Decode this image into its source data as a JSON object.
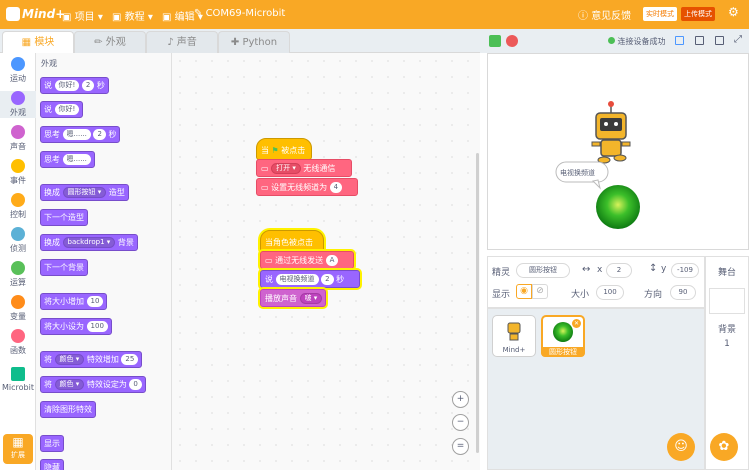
{
  "app": {
    "logo": "Mind+"
  },
  "menu": {
    "project": "项目",
    "tutorial": "教程",
    "edit": "编辑",
    "device": "COM69-Microbit"
  },
  "topright": {
    "feedback": "意见反馈",
    "realtime": "实时模式",
    "upload": "上传模式"
  },
  "tabs": [
    "模块",
    "外观",
    "声音",
    "Python"
  ],
  "stage_bar": {
    "connected": "连接设备成功"
  },
  "categories": [
    "运动",
    "外观",
    "声音",
    "事件",
    "控制",
    "侦测",
    "运算",
    "变量",
    "函数",
    "Microbit",
    "扩展"
  ],
  "category_colors": [
    "#4c97ff",
    "#9966ff",
    "#cf63cf",
    "#ffbf00",
    "#ffab19",
    "#5cb1d6",
    "#59c059",
    "#ff8c1a",
    "#ff6680",
    "#0fbd8c",
    "#ffab19"
  ],
  "palette": {
    "section_title": "外观",
    "say_secs": {
      "a": "说",
      "b": "你好!",
      "c": "2",
      "d": "秒"
    },
    "say": {
      "a": "说",
      "b": "你好!"
    },
    "think_secs": {
      "a": "思考",
      "b": "嗯......",
      "c": "2",
      "d": "秒"
    },
    "think": {
      "a": "思考",
      "b": "嗯......"
    },
    "switch_costume": {
      "a": "换成",
      "b": "圆形按钮",
      "c": "造型"
    },
    "next_costume": "下一个造型",
    "switch_backdrop": {
      "a": "换成",
      "b": "backdrop1",
      "c": "背景"
    },
    "next_backdrop": "下一个背景",
    "change_size": {
      "a": "将大小增加",
      "b": "10"
    },
    "set_size": {
      "a": "将大小设为",
      "b": "100"
    },
    "change_effect": {
      "a": "将",
      "b": "颜色",
      "c": "特效增加",
      "d": "25"
    },
    "set_effect": {
      "a": "将",
      "b": "颜色",
      "c": "特效设定为",
      "d": "0"
    },
    "clear_effects": "清除图形特效",
    "show": "显示",
    "hide": "隐藏"
  },
  "workspace": {
    "script1": {
      "hat_a": "当",
      "hat_b": "被点击",
      "open_a": "打开",
      "open_b": "无线通信",
      "group_a": "设置无线频道为",
      "group_b": "4"
    },
    "script2": {
      "hat": "当角色被点击",
      "send_a": "通过无线发送",
      "send_b": "A",
      "say_a": "说",
      "say_b": "电视换频道",
      "say_c": "2",
      "say_d": "秒",
      "sound_a": "播放声音",
      "sound_b": "啵"
    }
  },
  "stage": {
    "bubble": "电视换频道"
  },
  "sprite_info": {
    "sprite_label": "精灵",
    "sprite_name": "圆形按钮",
    "x_label": "x",
    "x": "2",
    "y_label": "y",
    "y": "-109",
    "show_label": "显示",
    "size_label": "大小",
    "size": "100",
    "direction_label": "方向",
    "direction": "90"
  },
  "sprites": [
    {
      "name": "Mind+"
    },
    {
      "name": "圆形按钮"
    }
  ],
  "stage_panel": {
    "title": "舞台",
    "backdrop_label": "背景",
    "backdrop_count": "1"
  },
  "zoom": {
    "in": "+",
    "out": "−",
    "reset": "="
  }
}
